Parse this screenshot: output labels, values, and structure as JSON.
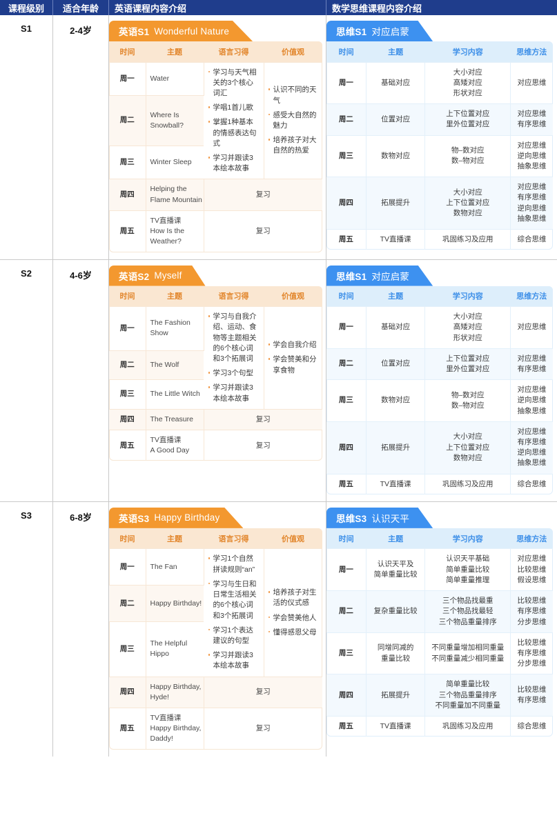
{
  "header": {
    "col_level": "课程级别",
    "col_age": "适合年龄",
    "col_english": "英语课程内容介绍",
    "col_math": "数学思维课程内容介绍"
  },
  "colors": {
    "header_band": "#1f3d8c",
    "english_accent": "#f3982f",
    "math_accent": "#3d91f0",
    "english_header_bg": "#fae7d2",
    "math_header_bg": "#ddeefb"
  },
  "english_columns": [
    "时间",
    "主题",
    "语言习得",
    "价值观"
  ],
  "math_columns": [
    "时间",
    "主题",
    "学习内容",
    "思维方法"
  ],
  "review_label": "复习",
  "levels": [
    {
      "level": "S1",
      "age": "2-4岁",
      "english": {
        "tab_num": "英语S1",
        "tab_sub": "Wonderful Nature",
        "days": [
          "周一",
          "周二",
          "周三",
          "周四",
          "周五"
        ],
        "topics": [
          [
            "Water"
          ],
          [
            "Where Is",
            "Snowball?"
          ],
          [
            "Winter Sleep"
          ],
          [
            "Helping the",
            "Flame Mountain"
          ],
          [
            "TV直播课",
            "How Is the",
            "Weather?"
          ]
        ],
        "language": [
          "学习与天气相关的3个核心词汇",
          "学唱1首儿歌",
          "掌握1种基本的情感表达句式",
          "学习并跟读3本绘本故事"
        ],
        "values": [
          "认识不同的天气",
          "感受大自然的魅力",
          "培养孩子对大自然的热爱"
        ]
      },
      "math": {
        "tab_num": "思维S1",
        "tab_sub": "对应启蒙",
        "rows": [
          {
            "day": "周一",
            "topic": [
              "基础对应"
            ],
            "content": [
              "大小对应",
              "高矮对应",
              "形状对应"
            ],
            "method": [
              "对应思维"
            ]
          },
          {
            "day": "周二",
            "topic": [
              "位置对应"
            ],
            "content": [
              "上下位置对应",
              "里外位置对应"
            ],
            "method": [
              "对应思维",
              "有序思维"
            ]
          },
          {
            "day": "周三",
            "topic": [
              "数物对应"
            ],
            "content": [
              "物–数对应",
              "数–物对应"
            ],
            "method": [
              "对应思维",
              "逆向思维",
              "抽象思维"
            ]
          },
          {
            "day": "周四",
            "topic": [
              "拓展提升"
            ],
            "content": [
              "大小对应",
              "上下位置对应",
              "数物对应"
            ],
            "method": [
              "对应思维",
              "有序思维",
              "逆向思维",
              "抽象思维"
            ]
          },
          {
            "day": "周五",
            "topic": [
              "TV直播课"
            ],
            "content": [
              "巩固练习及应用"
            ],
            "method": [
              "综合思维"
            ]
          }
        ]
      }
    },
    {
      "level": "S2",
      "age": "4-6岁",
      "english": {
        "tab_num": "英语S2",
        "tab_sub": "Myself",
        "days": [
          "周一",
          "周二",
          "周三",
          "周四",
          "周五"
        ],
        "topics": [
          [
            "The Fashion",
            "Show"
          ],
          [
            "The Wolf"
          ],
          [
            "The Little Witch"
          ],
          [
            "The Treasure"
          ],
          [
            "TV直播课",
            "A Good Day"
          ]
        ],
        "language": [
          "学习与自我介绍、运动、食物等主题相关的6个核心词和3个拓展词",
          "学习3个句型",
          "学习并跟读3本绘本故事"
        ],
        "values": [
          "学会自我介绍",
          "学会赞美和分享食物"
        ]
      },
      "math": {
        "tab_num": "思维S1",
        "tab_sub": "对应启蒙",
        "rows": [
          {
            "day": "周一",
            "topic": [
              "基础对应"
            ],
            "content": [
              "大小对应",
              "高矮对应",
              "形状对应"
            ],
            "method": [
              "对应思维"
            ]
          },
          {
            "day": "周二",
            "topic": [
              "位置对应"
            ],
            "content": [
              "上下位置对应",
              "里外位置对应"
            ],
            "method": [
              "对应思维",
              "有序思维"
            ]
          },
          {
            "day": "周三",
            "topic": [
              "数物对应"
            ],
            "content": [
              "物–数对应",
              "数–物对应"
            ],
            "method": [
              "对应思维",
              "逆向思维",
              "抽象思维"
            ]
          },
          {
            "day": "周四",
            "topic": [
              "拓展提升"
            ],
            "content": [
              "大小对应",
              "上下位置对应",
              "数物对应"
            ],
            "method": [
              "对应思维",
              "有序思维",
              "逆向思维",
              "抽象思维"
            ]
          },
          {
            "day": "周五",
            "topic": [
              "TV直播课"
            ],
            "content": [
              "巩固练习及应用"
            ],
            "method": [
              "综合思维"
            ]
          }
        ]
      }
    },
    {
      "level": "S3",
      "age": "6-8岁",
      "english": {
        "tab_num": "英语S3",
        "tab_sub": "Happy Birthday",
        "days": [
          "周一",
          "周二",
          "周三",
          "周四",
          "周五"
        ],
        "topics": [
          [
            "The Fan"
          ],
          [
            "Happy Birthday!"
          ],
          [
            "The Helpful",
            "Hippo"
          ],
          [
            "Happy Birthday,",
            "Hyde!"
          ],
          [
            "TV直播课",
            "Happy Birthday,",
            "Daddy!"
          ]
        ],
        "language": [
          "学习1个自然拼读规则“an”",
          "学习与生日和日常生活相关的6个核心词和3个拓展词",
          "学习1个表达建议的句型",
          "学习并跟读3本绘本故事"
        ],
        "values": [
          "培养孩子对生活的仪式感",
          "学会赞美他人",
          "懂得感恩父母"
        ]
      },
      "math": {
        "tab_num": "思维S3",
        "tab_sub": "认识天平",
        "rows": [
          {
            "day": "周一",
            "topic": [
              "认识天平及",
              "简单重量比较"
            ],
            "content": [
              "认识天平基础",
              "简单重量比较",
              "简单重量推理"
            ],
            "method": [
              "对应思维",
              "比较思维",
              "假设思维"
            ]
          },
          {
            "day": "周二",
            "topic": [
              "复杂重量比较"
            ],
            "content": [
              "三个物品找最重",
              "三个物品找最轻",
              "三个物品重量排序"
            ],
            "method": [
              "比较思维",
              "有序思维",
              "分步思维"
            ]
          },
          {
            "day": "周三",
            "topic": [
              "同增同减的",
              "重量比较"
            ],
            "content": [
              "不同重量增加相同重量",
              "不同重量减少相同重量"
            ],
            "method": [
              "比较思维",
              "有序思维",
              "分步思维"
            ]
          },
          {
            "day": "周四",
            "topic": [
              "拓展提升"
            ],
            "content": [
              "简单重量比较",
              "三个物品重量排序",
              "不同重量加不同重量"
            ],
            "method": [
              "比较思维",
              "有序思维"
            ]
          },
          {
            "day": "周五",
            "topic": [
              "TV直播课"
            ],
            "content": [
              "巩固练习及应用"
            ],
            "method": [
              "综合思维"
            ]
          }
        ]
      }
    }
  ]
}
